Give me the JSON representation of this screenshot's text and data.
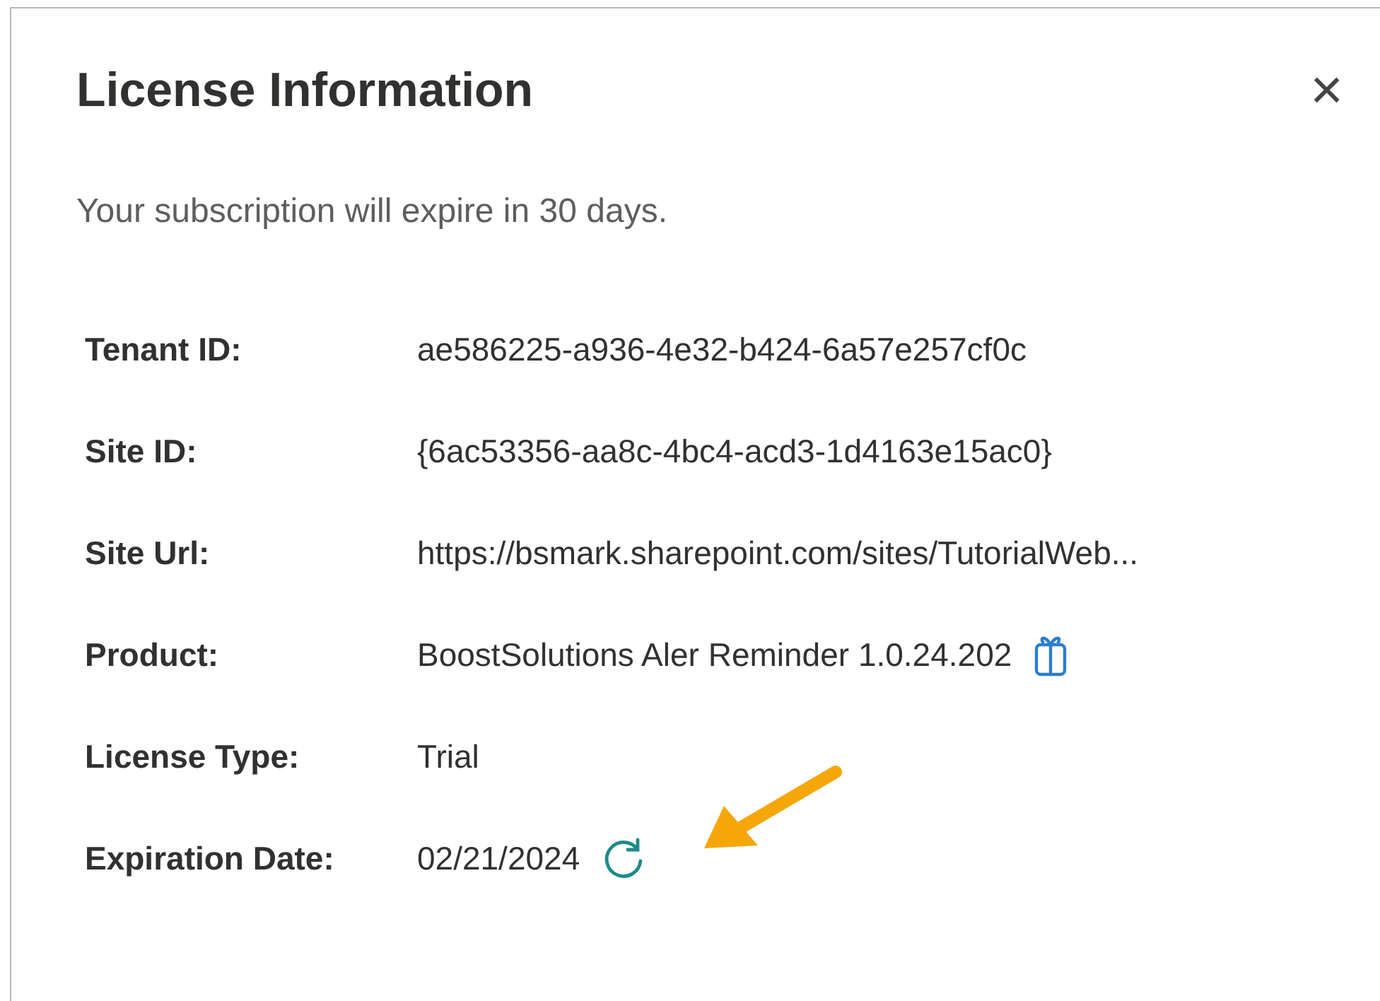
{
  "dialog": {
    "title": "License Information",
    "close_label": "×",
    "message": "Your subscription will expire in 30 days.",
    "fields": [
      {
        "label": "Tenant ID:",
        "value": "ae586225-a936-4e32-b424-6a57e257cf0c",
        "kind": "text"
      },
      {
        "label": "Site ID:",
        "value": "{6ac53356-aa8c-4bc4-acd3-1d4163e15ac0}",
        "kind": "text"
      },
      {
        "label": "Site Url:",
        "value": "https://bsmark.sharepoint.com/sites/TutorialWeb...",
        "kind": "text"
      },
      {
        "label": "Product:",
        "value": "BoostSolutions Aler Reminder 1.0.24.202",
        "kind": "product"
      },
      {
        "label": "License Type:",
        "value": "Trial",
        "kind": "text"
      },
      {
        "label": "Expiration Date:",
        "value": "02/21/2024",
        "kind": "renewal"
      }
    ]
  }
}
